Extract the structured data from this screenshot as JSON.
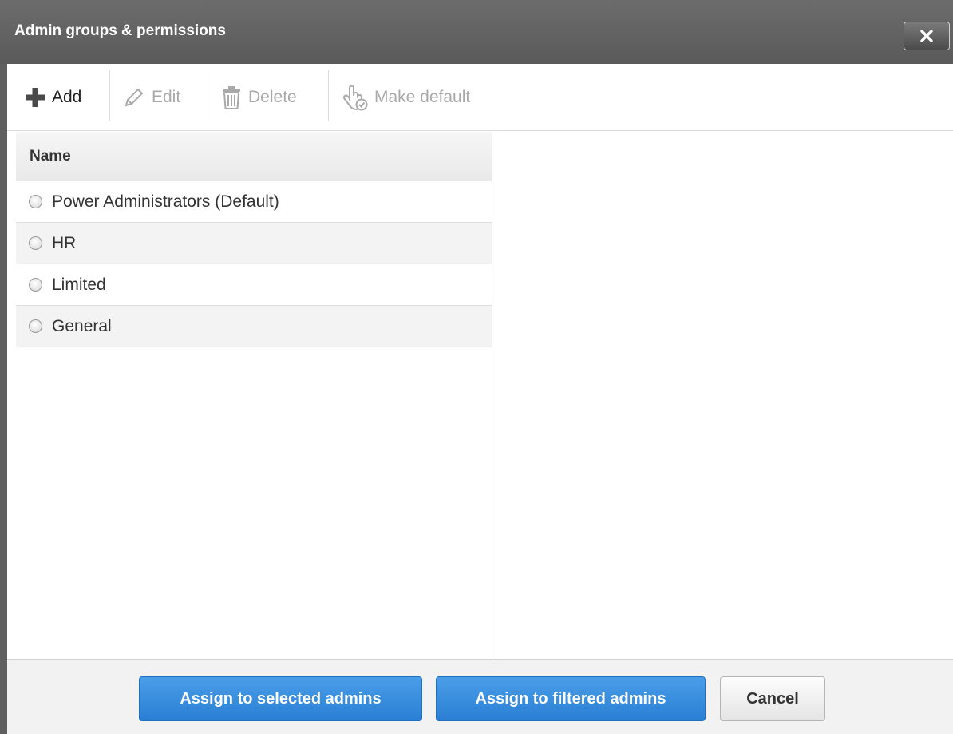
{
  "dialog": {
    "title": "Admin groups & permissions",
    "close_icon": "close-icon"
  },
  "toolbar": {
    "add": {
      "label": "Add",
      "icon": "plus-icon",
      "enabled": true
    },
    "edit": {
      "label": "Edit",
      "icon": "pencil-icon",
      "enabled": false
    },
    "delete": {
      "label": "Delete",
      "icon": "trash-icon",
      "enabled": false
    },
    "make_default": {
      "label": "Make default",
      "icon": "hand-check-icon",
      "enabled": false
    }
  },
  "groups_table": {
    "column_header": "Name",
    "rows": [
      {
        "label": "Power Administrators (Default)",
        "selected": false
      },
      {
        "label": "HR",
        "selected": false
      },
      {
        "label": "Limited",
        "selected": false
      },
      {
        "label": "General",
        "selected": false
      }
    ]
  },
  "footer": {
    "assign_selected": "Assign to selected admins",
    "assign_filtered": "Assign to filtered admins",
    "cancel": "Cancel"
  },
  "colors": {
    "titlebar": "#5f5f5f",
    "primary_button": "#2a7fd4",
    "disabled_text": "#a9a9a9"
  }
}
